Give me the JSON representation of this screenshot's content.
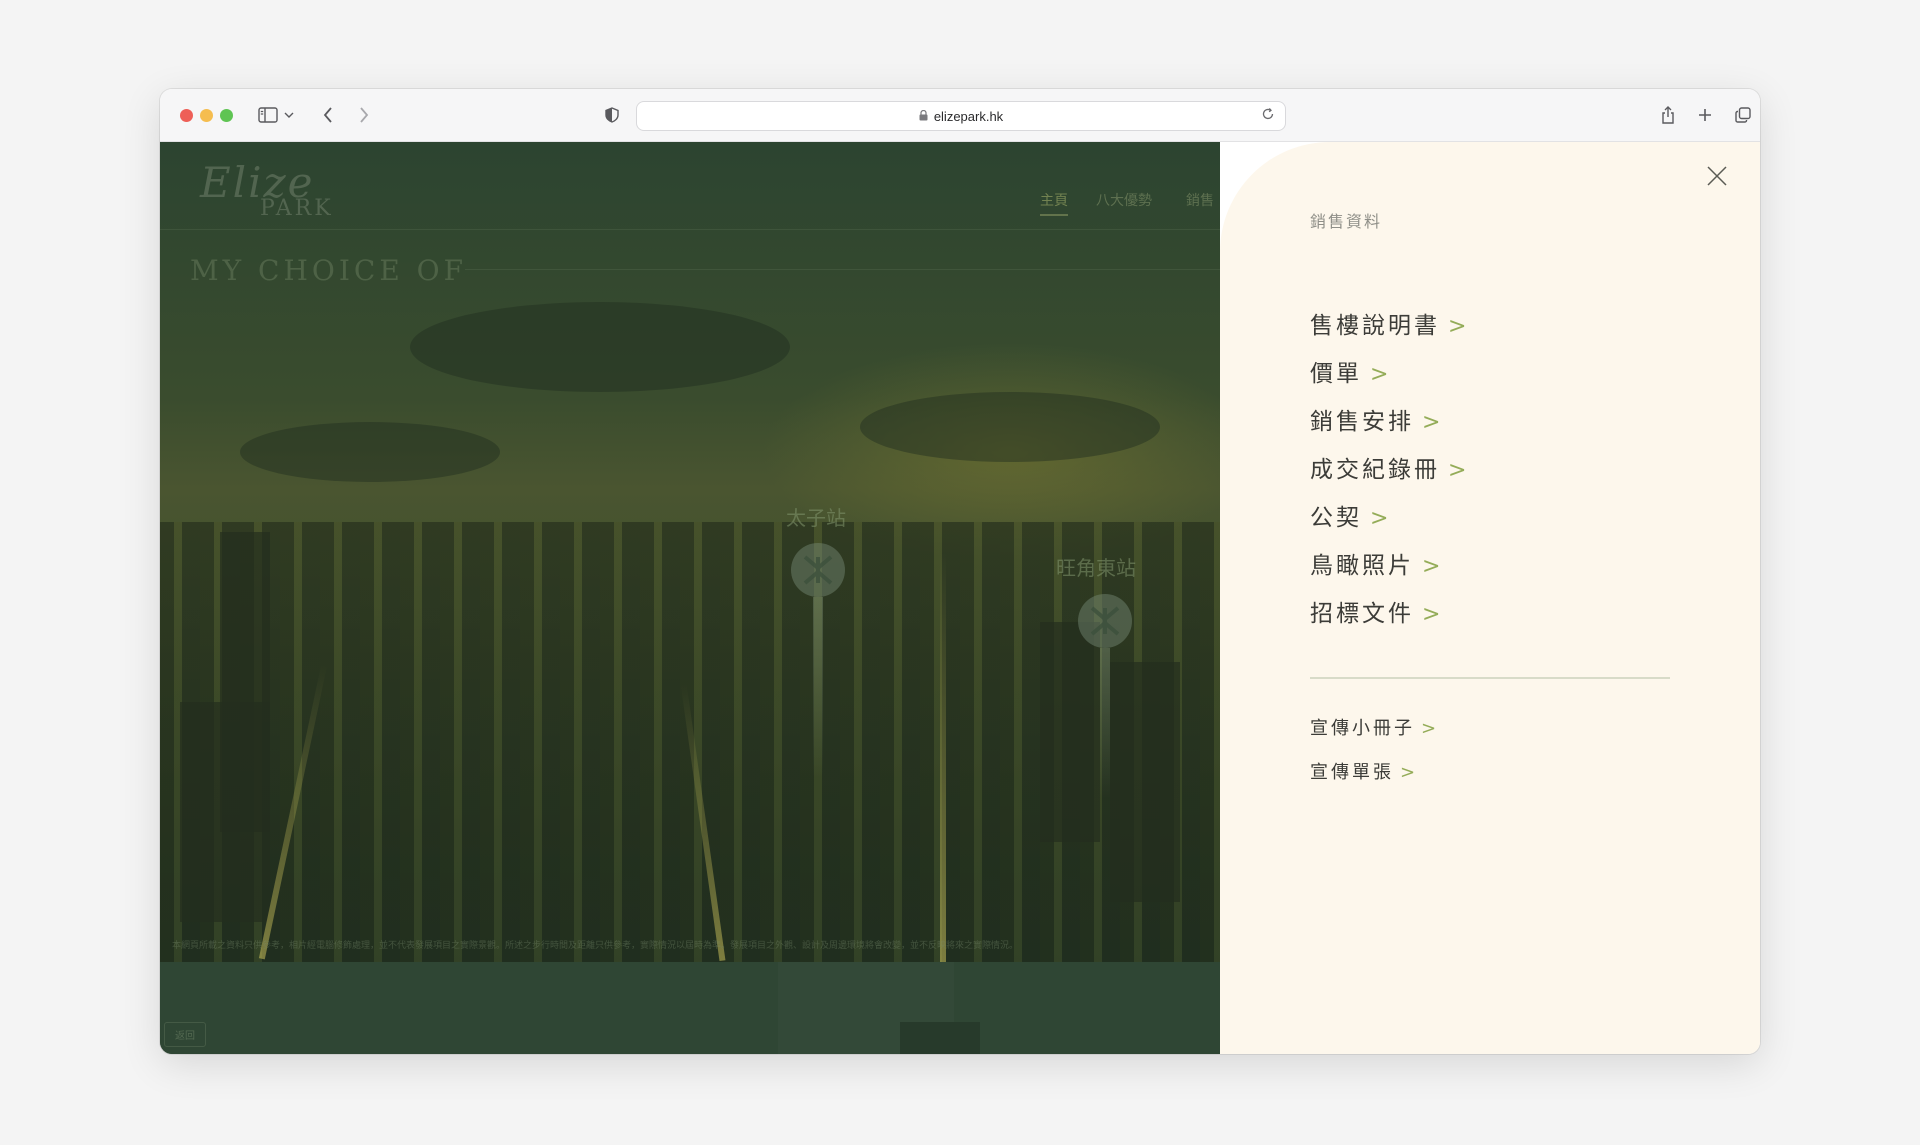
{
  "browser": {
    "url": "elizepark.hk"
  },
  "site": {
    "logo_script": "Elize",
    "logo_word": "PARK",
    "nav": [
      "主頁",
      "八大優勢",
      "銷售"
    ],
    "headline": "MY CHOICE OF",
    "stations": [
      {
        "name": "太子站"
      },
      {
        "name": "旺角東站"
      }
    ],
    "disclaimer": "本網頁所載之資料只供參考，相片經電腦修飾處理，並不代表發展項目之實際景觀。所述之步行時間及距離只供參考，實際情況以屆時為準。發展項目之外觀、設計及周邊環境將會改變，並不反映將來之實際情況。",
    "small_button": "返回"
  },
  "menu": {
    "section_title": "銷售資料",
    "arrow": ">",
    "items": [
      {
        "label": "售樓說明書"
      },
      {
        "label": "價單"
      },
      {
        "label": "銷售安排"
      },
      {
        "label": "成交紀錄冊"
      },
      {
        "label": "公契"
      },
      {
        "label": "鳥瞰照片"
      },
      {
        "label": "招標文件"
      }
    ],
    "secondary_items": [
      {
        "label": "宣傳小冊子"
      },
      {
        "label": "宣傳單張"
      }
    ]
  }
}
